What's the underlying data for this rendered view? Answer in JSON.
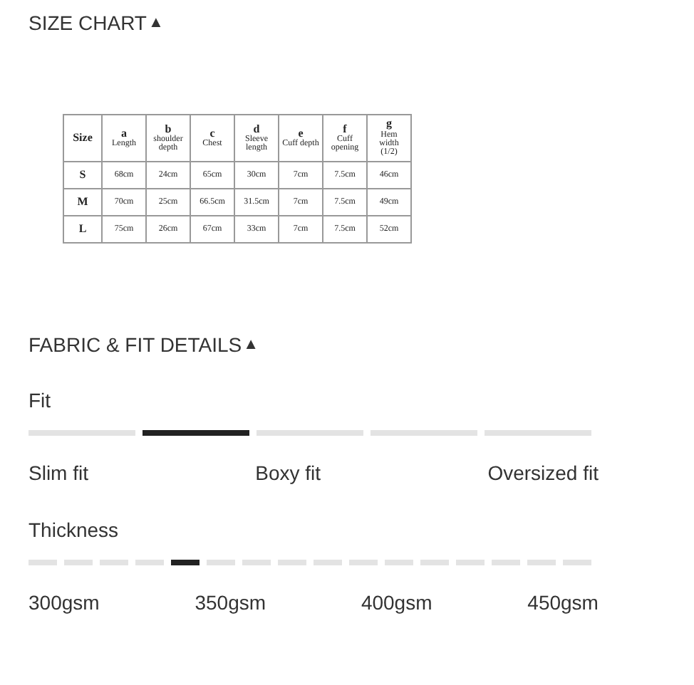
{
  "size_chart": {
    "title": "SIZE CHART",
    "toggle": "▲",
    "columns": [
      {
        "label": "Size"
      },
      {
        "letter": "a",
        "label": "Length"
      },
      {
        "letter": "b",
        "label": "shoulder depth"
      },
      {
        "letter": "c",
        "label": "Chest"
      },
      {
        "letter": "d",
        "label": "Sleeve length"
      },
      {
        "letter": "e",
        "label": "Cuff depth"
      },
      {
        "letter": "f",
        "label": "Cuff opening"
      },
      {
        "letter": "g",
        "label": "Hem width (1/2)"
      }
    ],
    "rows": [
      [
        "S",
        "68cm",
        "24cm",
        "65cm",
        "30cm",
        "7cm",
        "7.5cm",
        "46cm"
      ],
      [
        "M",
        "70cm",
        "25cm",
        "66.5cm",
        "31.5cm",
        "7cm",
        "7.5cm",
        "49cm"
      ],
      [
        "L",
        "75cm",
        "26cm",
        "67cm",
        "33cm",
        "7cm",
        "7.5cm",
        "52cm"
      ]
    ]
  },
  "fabric": {
    "title": "FABRIC & FIT DETAILS",
    "toggle": "▲",
    "scales": [
      {
        "label": "Fit",
        "segments": [
          {
            "selected": false
          },
          {
            "selected": true
          },
          {
            "selected": false
          },
          {
            "selected": false
          },
          {
            "selected": false
          }
        ],
        "ticks": [
          "Slim fit",
          "Boxy fit",
          "Oversized fit"
        ]
      },
      {
        "label": "Thickness",
        "segments": [
          {
            "selected": false
          },
          {
            "selected": false
          },
          {
            "selected": false
          },
          {
            "selected": false
          },
          {
            "selected": true
          },
          {
            "selected": false
          },
          {
            "selected": false
          },
          {
            "selected": false
          },
          {
            "selected": false
          },
          {
            "selected": false
          },
          {
            "selected": false
          },
          {
            "selected": false
          },
          {
            "selected": false
          },
          {
            "selected": false
          },
          {
            "selected": false
          },
          {
            "selected": false
          }
        ],
        "ticks": [
          "300gsm",
          "350gsm",
          "400gsm",
          "450gsm"
        ]
      }
    ]
  }
}
